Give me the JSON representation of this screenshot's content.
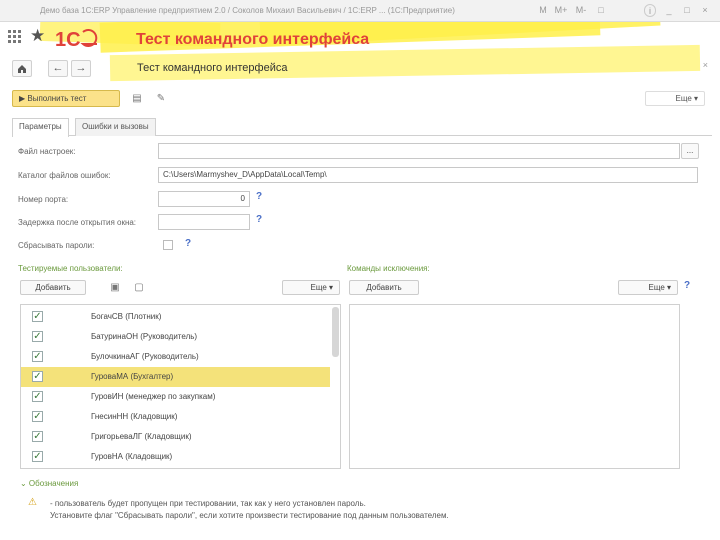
{
  "window": {
    "title": "Демо база 1С:ERP Управление предприятием 2.0 / Соколов Михаил Васильевич / 1С:ERP ... (1С:Предприятие)",
    "controls": [
      "M",
      "M+",
      "M-",
      "□",
      "i",
      "_",
      "□",
      "×"
    ]
  },
  "header": {
    "app_title": "Тест командного интерфейса",
    "logo_text": "1С"
  },
  "nav": {
    "home_icon": "home-icon",
    "back": "←",
    "forward": "→",
    "form_title": "Тест командного интерфейса",
    "close": "×"
  },
  "toolbar": {
    "run_label": "▶ Выполнить тест",
    "more_label": "Еще ▾"
  },
  "tabs": [
    {
      "label": "Параметры",
      "active": true
    },
    {
      "label": "Ошибки и вызовы",
      "active": false
    }
  ],
  "fields": {
    "settings_file_label": "Файл настроек:",
    "settings_file_value": "",
    "settings_file_button": "...",
    "error_dir_label": "Каталог файлов ошибок:",
    "error_dir_value": "C:\\Users\\Marmyshev_D\\AppData\\Local\\Temp\\",
    "port_label": "Номер порта:",
    "port_value": "0",
    "delay_label": "Задержка после открытия окна:",
    "delay_value": "",
    "reset_passwords_label": "Сбрасывать пароли:",
    "help": "?"
  },
  "users_section": {
    "title": "Тестируемые пользователи:",
    "add_button": "Добавить",
    "more_label": "Еще ▾",
    "rows": [
      {
        "checked": true,
        "name": "БогачСВ (Плотник)",
        "selected": false
      },
      {
        "checked": true,
        "name": "БатуринаОН (Руководитель)",
        "selected": false
      },
      {
        "checked": true,
        "name": "БулочкинаАГ (Руководитель)",
        "selected": false
      },
      {
        "checked": true,
        "name": "ГуроваМА (Бухгалтер)",
        "selected": true
      },
      {
        "checked": true,
        "name": "ГуровИН (менеджер по закупкам)",
        "selected": false
      },
      {
        "checked": true,
        "name": "ГнесинНН (Кладовщик)",
        "selected": false
      },
      {
        "checked": true,
        "name": "ГригорьеваЛГ (Кладовщик)",
        "selected": false
      },
      {
        "checked": true,
        "name": "ГуровНА (Кладовщик)",
        "selected": false
      }
    ]
  },
  "commands_section": {
    "title": "Команды исключения:",
    "add_button": "Добавить",
    "more_label": "Еще ▾",
    "help": "?"
  },
  "notes": {
    "toggle": "⌄ Обозначения",
    "line1": "- пользователь будет пропущен при тестировании, так как у него установлен пароль.",
    "line2": "Установите флаг \"Сбрасывать пароли\", если хотите произвести тестирование под данным пользователем."
  },
  "colors": {
    "accent_red": "#e0423a",
    "highlight_yellow": "#fff04a",
    "selected_row": "#f4e27a",
    "section_green": "#6b9a3e"
  }
}
